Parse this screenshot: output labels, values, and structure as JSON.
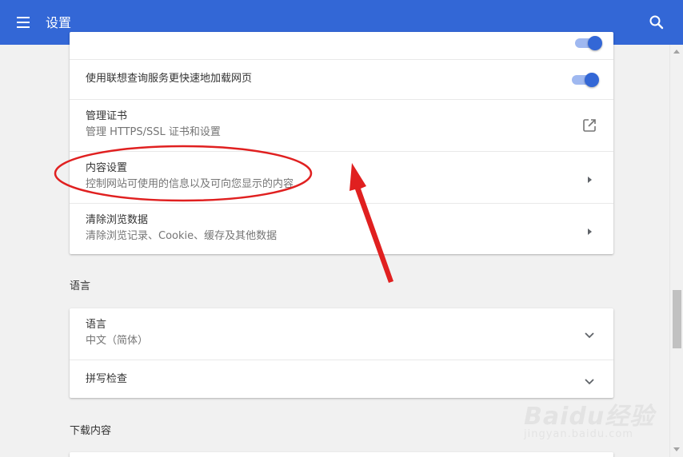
{
  "app": {
    "title": "设置"
  },
  "privacy_card": {
    "preload": {
      "label": "使用联想查询服务更快速地加载网页",
      "enabled": true
    },
    "certificates": {
      "label": "管理证书",
      "description": "管理 HTTPS/SSL 证书和设置"
    },
    "content_settings": {
      "label": "内容设置",
      "description": "控制网站可使用的信息以及可向您显示的内容"
    },
    "clear_data": {
      "label": "清除浏览数据",
      "description": "清除浏览记录、Cookie、缓存及其他数据"
    }
  },
  "language_section": {
    "title": "语言",
    "language": {
      "label": "语言",
      "value": "中文（简体）"
    },
    "spellcheck": {
      "label": "拼写检查"
    }
  },
  "downloads_section": {
    "title": "下载内容"
  },
  "watermark": {
    "text": "Baidu经验",
    "url": "jingyan.baidu.com"
  },
  "colors": {
    "toolbar": "#3367d6",
    "toggle_on": "#3367d6",
    "annotation": "#e02020"
  }
}
